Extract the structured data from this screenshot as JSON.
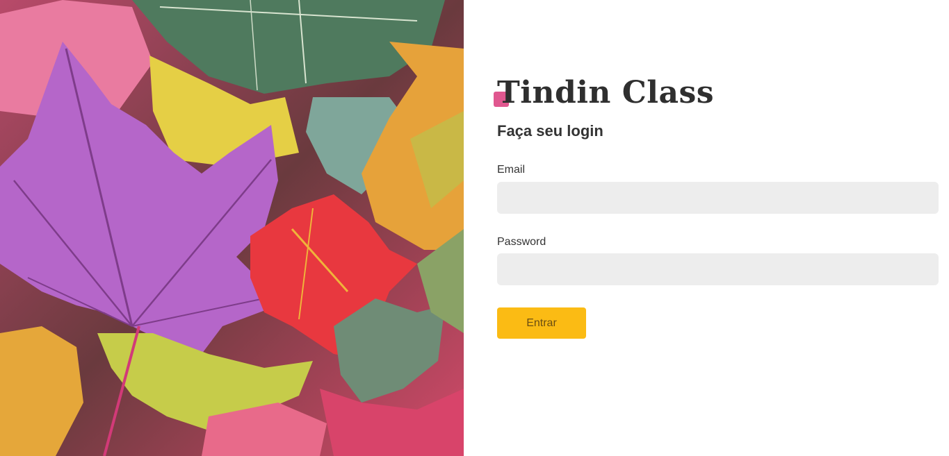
{
  "brand": {
    "name": "Tindin Class",
    "accent_color": "#e0578f"
  },
  "login": {
    "title": "Faça seu login",
    "email_label": "Email",
    "email_value": "",
    "password_label": "Password",
    "password_value": "",
    "submit_label": "Entrar",
    "button_color": "#fbbb14"
  },
  "hero": {
    "icon": "autumn-leaves-image"
  }
}
